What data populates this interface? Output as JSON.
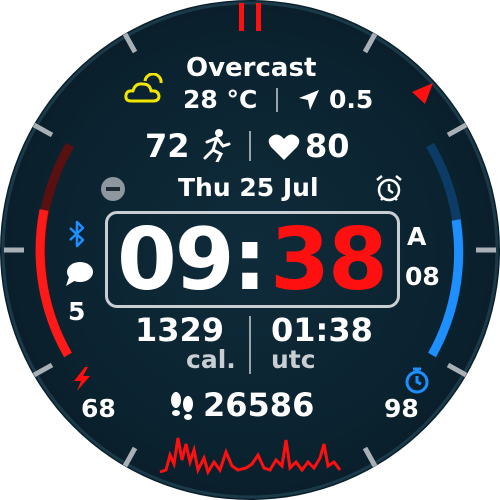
{
  "weather": {
    "condition": "Overcast",
    "temperature": "28 °C",
    "wind": "0.5",
    "icon": "cloud-sun-icon"
  },
  "activity": {
    "stairs_or_intensity": "72",
    "heart_rate": "80"
  },
  "date": "Thu 25 Jul",
  "time": {
    "hours": "09",
    "colon": ":",
    "minutes": "38"
  },
  "left_stats": {
    "notifications": "5",
    "battery": "68"
  },
  "right_stats": {
    "am_pm": "A",
    "seconds": "08",
    "timer_value": "98"
  },
  "calories": {
    "value": "1329",
    "label": "cal."
  },
  "utc": {
    "value": "01:38",
    "label": "utc"
  },
  "steps": "26586",
  "colors": {
    "accent_red": "#ff1010",
    "accent_blue": "#1e8fff",
    "warning_yellow": "#f2e600",
    "text": "#ffffff"
  }
}
